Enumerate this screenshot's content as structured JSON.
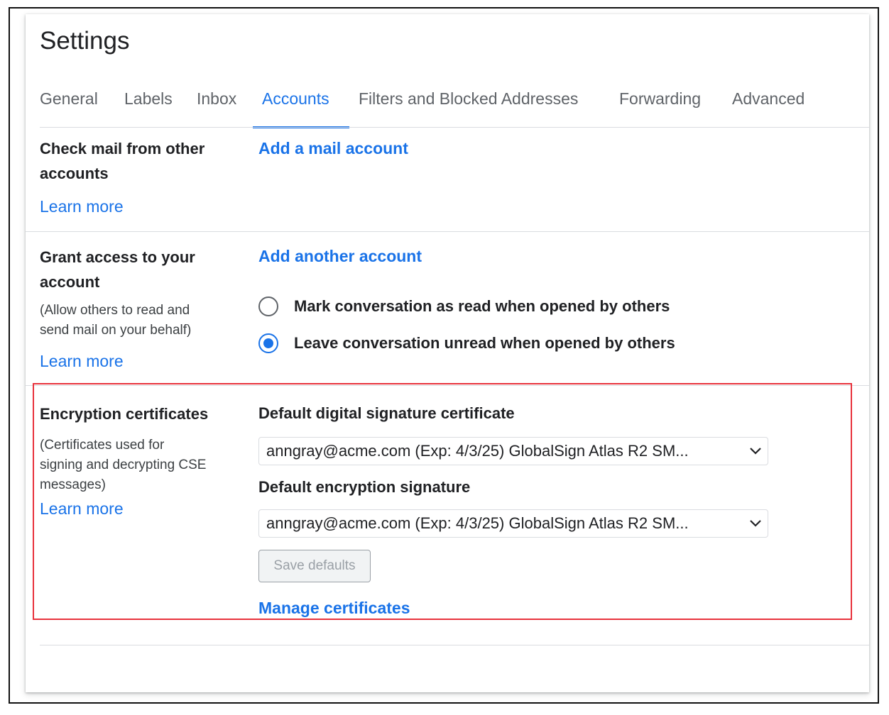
{
  "title": "Settings",
  "tabs": [
    {
      "label": "General"
    },
    {
      "label": "Labels"
    },
    {
      "label": "Inbox"
    },
    {
      "label": "Accounts"
    },
    {
      "label": "Filters and Blocked Addresses"
    },
    {
      "label": "Forwarding"
    },
    {
      "label": "Advanced"
    }
  ],
  "active_tab": "Accounts",
  "check_mail": {
    "title_line1": "Check mail from other",
    "title_line2": "accounts",
    "learn_more": "Learn more",
    "action": "Add a mail account"
  },
  "grant_access": {
    "title_line1": "Grant access to your",
    "title_line2": "account",
    "desc_line1": "(Allow others to read and",
    "desc_line2": "send mail on your behalf)",
    "learn_more": "Learn more",
    "action": "Add another account",
    "options": [
      {
        "label": "Mark conversation as read when opened by others",
        "checked": false
      },
      {
        "label": "Leave conversation unread when opened by others",
        "checked": true
      }
    ]
  },
  "encryption": {
    "title": "Encryption certificates",
    "desc_line1": "(Certificates used for",
    "desc_line2": "signing and decrypting CSE",
    "desc_line3": "messages)",
    "learn_more": "Learn more",
    "signature_label": "Default digital signature certificate",
    "signature_value": "anngray@acme.com (Exp: 4/3/25) GlobalSign Atlas R2 SM...",
    "encryption_label": "Default encryption signature",
    "encryption_value": "anngray@acme.com (Exp: 4/3/25) GlobalSign Atlas R2 SM...",
    "save_button": "Save defaults",
    "manage_link": "Manage certificates"
  },
  "colors": {
    "accent": "#1a73e8",
    "highlight_border": "#e8323c"
  }
}
